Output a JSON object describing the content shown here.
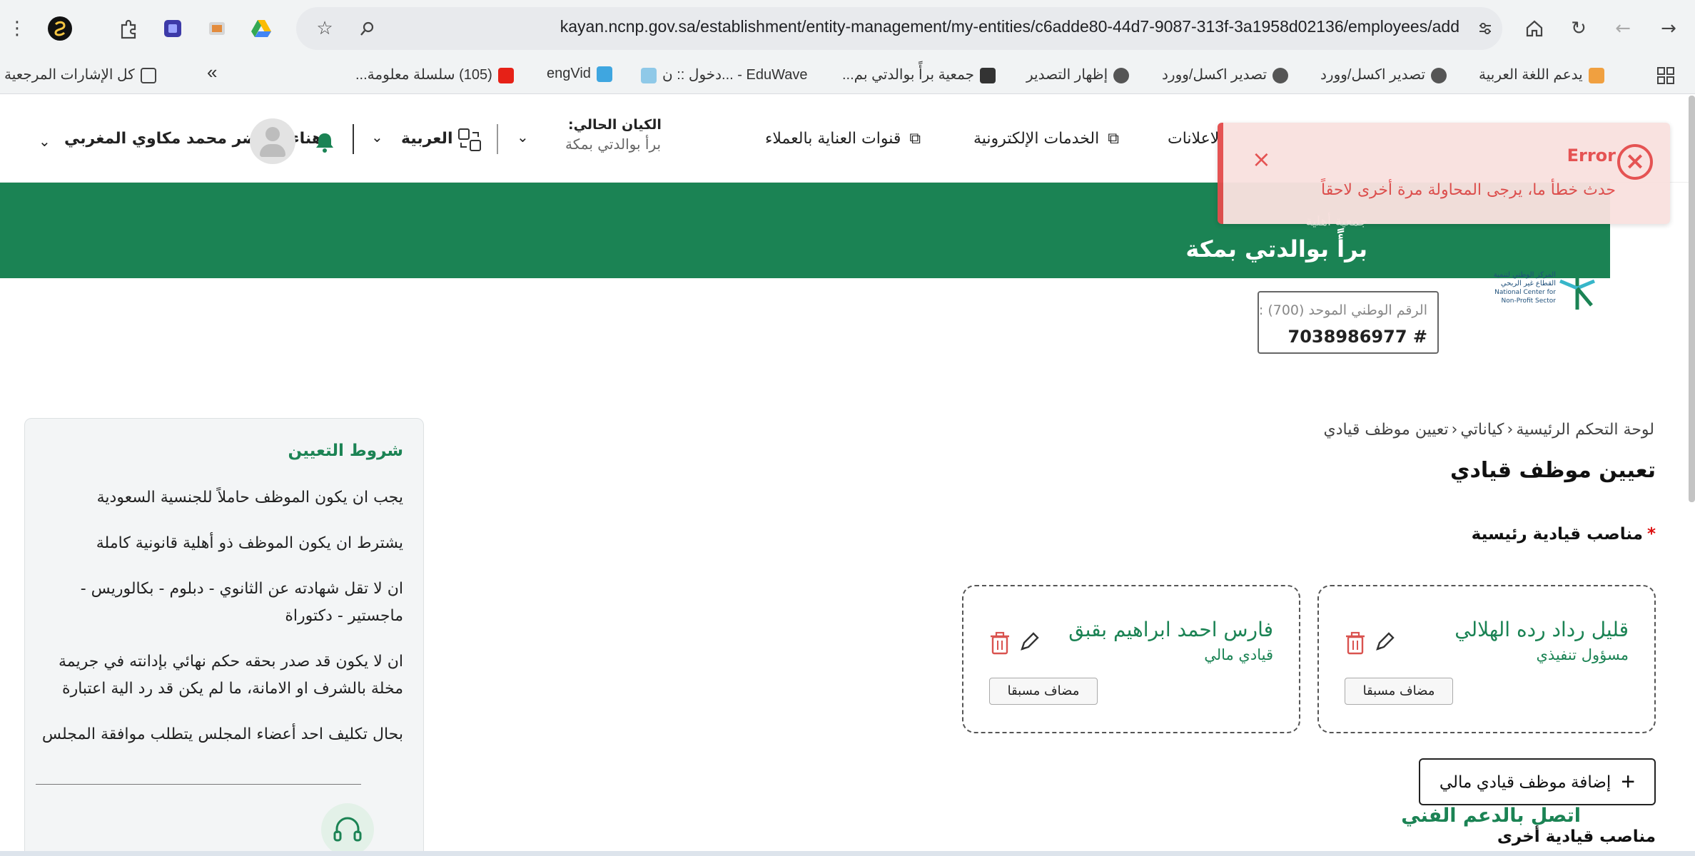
{
  "browser": {
    "url": "kayan.ncnp.gov.sa/establishment/entity-management/my-entities/c6adde80-44d7-9087-313f-3a1958d02136/employees/add",
    "bookmarks": [
      "يدعم اللغة العربية",
      "تصدير اكسل/وورد",
      "تصدير اكسل/وورد",
      "إظهار التصدير",
      "جمعية برأً بوالدتي بم...",
      "دخول :: ن... - EduWave",
      "engVid",
      "(105) سلسلة معلومة...",
      "كل الإشارات المرجعية"
    ]
  },
  "header": {
    "user_name": "هناء الأخضر محمد مكاوي المغربي",
    "language": "العربية",
    "current_entity_label": "الكيان الحالي:",
    "current_entity_value": "برأ بوالدتي بمكة",
    "nav": [
      "قنوات العناية بالعملاء",
      "الخدمات الإلكترونية",
      "لاعلانات"
    ]
  },
  "toast": {
    "title": "Error",
    "message": "حدث خطأ ما، يرجى المحاولة مرة أخرى لاحقاً",
    "close": "×",
    "icon": "×"
  },
  "banner": {
    "subtitle": "جمعية أهلية",
    "title": "برأً بوالدتي بمكة"
  },
  "logo": {
    "line1": "المركز الوطني لتنمية",
    "line2": "القطاع غير الربحي",
    "line3": "National Center for",
    "line4": "Non-Profit Sector"
  },
  "national_id": {
    "label": "الرقم الوطني الموحد (700) :",
    "value": "7038986977 #"
  },
  "breadcrumb": {
    "home": "لوحة التحكم الرئيسية",
    "entities": "كياناتي",
    "current": "تعيين موظف قيادي"
  },
  "page": {
    "title": "تعيين موظف قيادي",
    "main_section": "مناصب قيادية رئيسية",
    "required_mark": "*",
    "add_button": "إضافة موظف قيادي مالي",
    "add_icon": "+",
    "other_section": "مناصب قيادية أخرى"
  },
  "cards": [
    {
      "name": "قليل رداد رده الهلالي",
      "role": "مسؤول تنفيذي",
      "badge": "مضاف مسبقا"
    },
    {
      "name": "فارس احمد ابراهيم بقبق",
      "role": "قيادي مالي",
      "badge": "مضاف مسبقا"
    }
  ],
  "conditions": {
    "title": "شروط التعيين",
    "items": [
      "يجب ان يكون الموظف حاملاً للجنسية السعودية",
      "يشترط ان يكون الموظف ذو أهلية قانونية كاملة",
      "ان لا تقل شهادته عن الثانوي - دبلوم - بكالوريس - ماجستير - دكتوراة",
      "ان لا يكون قد صدر بحقه حكم نهائي بإدانته في جريمة مخلة بالشرف او الامانة، ما لم يكن قد رد الية اعتبارة",
      "بحال تكليف احد أعضاء المجلس يتطلب موافقة المجلس"
    ],
    "support": "اتصل بالدعم الفني"
  },
  "colors": {
    "brand_green": "#1b8354",
    "error_red": "#e44d4d",
    "toast_bg": "#f9e1df"
  }
}
